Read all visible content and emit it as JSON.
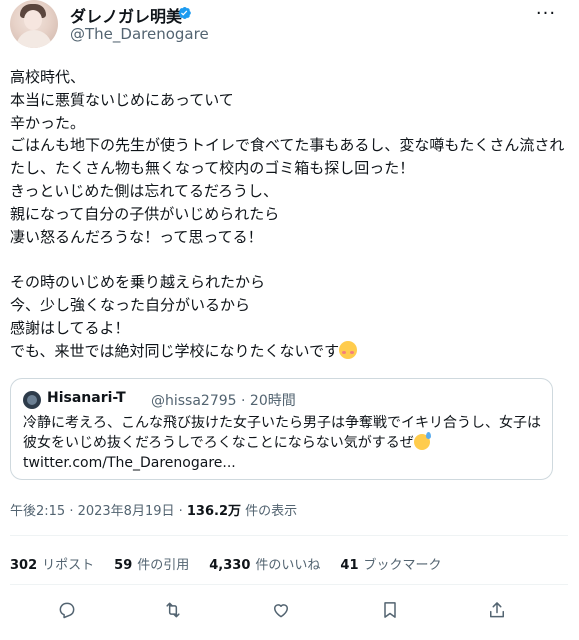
{
  "author": {
    "display_name": "ダレノガレ明美",
    "handle": "@The_Darenogare",
    "verified": true
  },
  "tweet": {
    "text": "高校時代、\n本当に悪質ないじめにあっていて\n辛かった。\nごはんも地下の先生が使うトイレで食べてた事もあるし、変な噂もたくさん流されたし、たくさん物も無くなって校内のゴミ箱も探し回った！\nきっといじめた側は忘れてるだろうし、\n親になって自分の子供がいじめられたら\n凄い怒るんだろうな！って思ってる！\n\nその時のいじめを乗り越えられたから\n今、少し強くなった自分がいるから\n感謝はしてるよ！\nでも、来世では絶対同じ学校になりたくないです",
    "trailing_emoji": "smiling-face-with-blush-emoji"
  },
  "quoted_tweet": {
    "display_name": "Hisanari-T",
    "handle_time": "@hissa2795 · 20時間",
    "text": "冷静に考えろ、こんな飛び抜けた女子いたら男子は争奪戦でイキリ合うし、女子は彼女をいじめ抜くだろうしでろくなことにならない気がするぜ",
    "trailing_emoji": "grinning-sweat-emoji",
    "link": "twitter.com/The_Darenogare..."
  },
  "meta": {
    "datetime": "午後2:15 · 2023年8月19日 · ",
    "views_count": "136.2万",
    "views_label": " 件の表示"
  },
  "stats": [
    {
      "num": "302",
      "label": "リポスト"
    },
    {
      "num": "59",
      "label": "件の引用"
    },
    {
      "num": "4,330",
      "label": "件のいいね"
    },
    {
      "num": "41",
      "label": "ブックマーク"
    }
  ],
  "actions": [
    "reply-icon",
    "retweet-icon",
    "like-icon",
    "bookmark-icon",
    "share-icon"
  ],
  "colors": {
    "text": "#0f1419",
    "secondary": "#536471",
    "verified": "#1d9bf0",
    "border": "#cfd9de"
  }
}
